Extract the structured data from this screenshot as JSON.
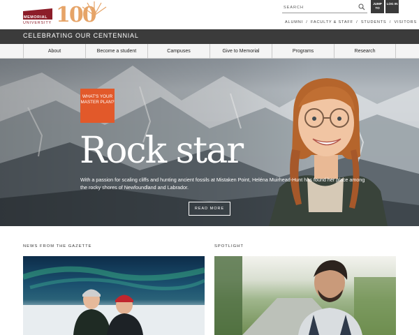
{
  "header": {
    "university_line1": "MEMORIAL",
    "university_line2": "UNIVERSITY",
    "logo_100": "100",
    "search_placeholder": "SEARCH",
    "jump_to": "JUMP TO",
    "log_in": "LOG IN",
    "audience_links": [
      "ALUMNI",
      "FACULTY & STAFF",
      "STUDENTS",
      "VISITORS"
    ],
    "separator": "/"
  },
  "banner": {
    "text": "CELEBRATING OUR CENTENNIAL"
  },
  "nav": {
    "items": [
      "About",
      "Become a student",
      "Campuses",
      "Give to Memorial",
      "Programs",
      "Research"
    ]
  },
  "hero": {
    "badge": "WHAT'S YOUR MASTER PLAN?",
    "title": "Rock star",
    "description": "With a passion for scaling cliffs and hunting ancient fossils at Mistaken Point, Heléna Muirhead-Hunt has found her place among the rocky shores of Newfoundland and Labrador.",
    "cta": "READ MORE"
  },
  "sections": {
    "gazette_label": "NEWS FROM THE GAZETTE",
    "spotlight_label": "SPOTLIGHT"
  },
  "colors": {
    "brand_maroon": "#8c1d29",
    "centennial_gold": "#e6a468",
    "badge_orange": "#e2592a",
    "dark_bar": "#3b3b3b"
  }
}
